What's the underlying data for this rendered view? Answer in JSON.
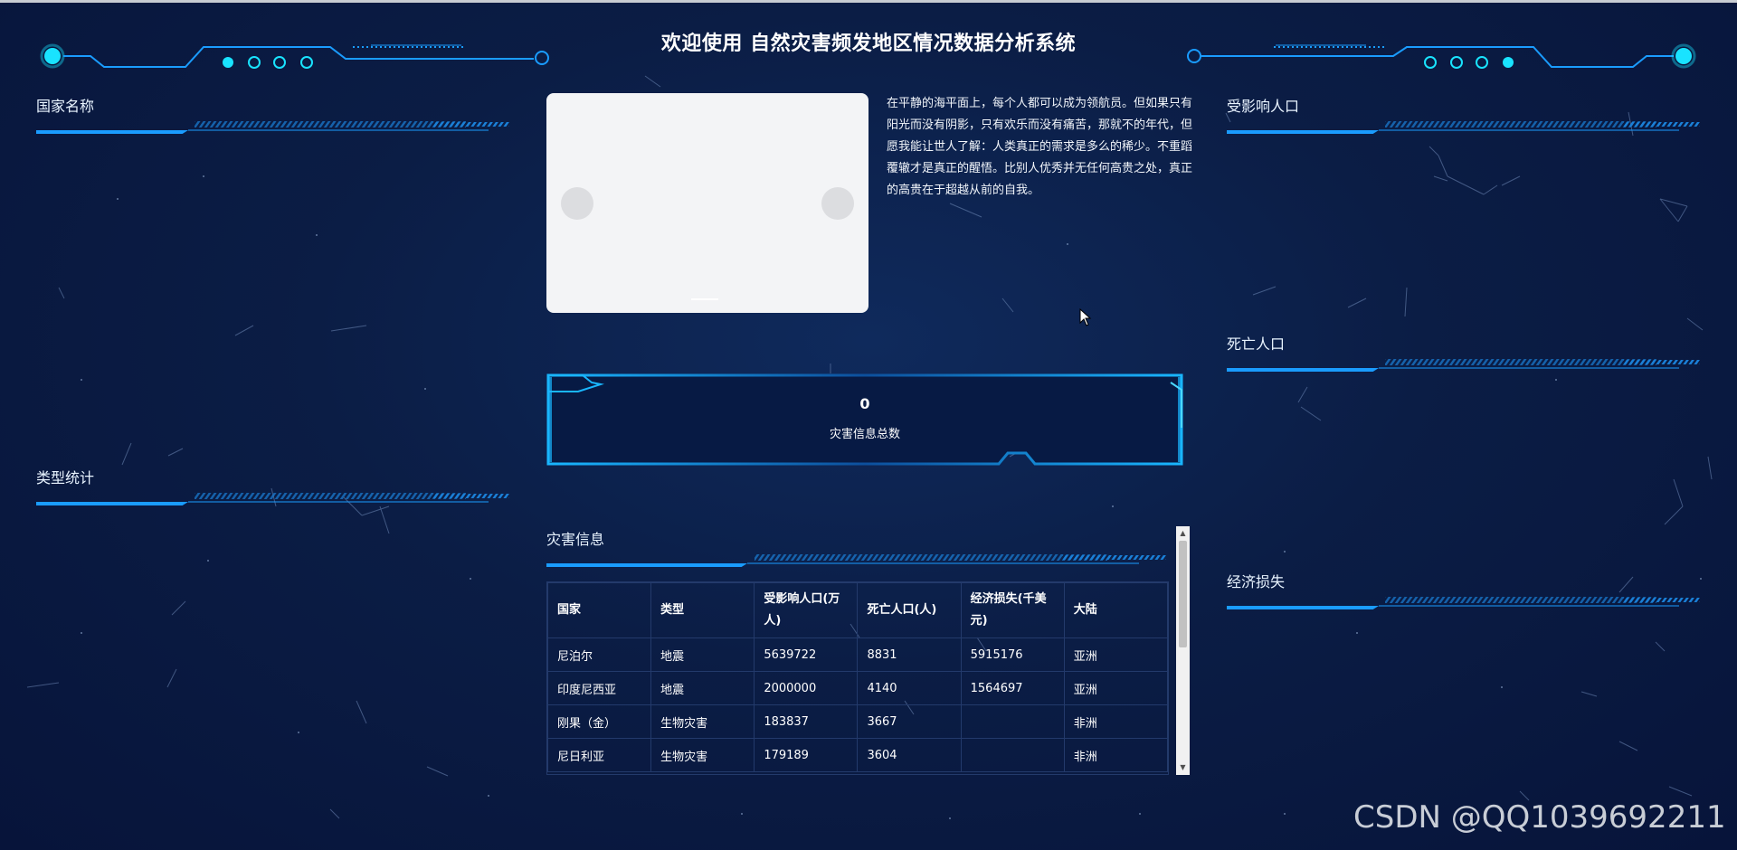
{
  "header": {
    "title": "欢迎使用 自然灾害频发地区情况数据分析系统"
  },
  "panels": {
    "country_name": "国家名称",
    "type_stats": "类型统计",
    "affected_population": "受影响人口",
    "death_population": "死亡人口",
    "economic_loss": "经济损失",
    "disaster_info": "灾害信息"
  },
  "quote": "在平静的海平面上，每个人都可以成为领航员。但如果只有阳光而没有阴影，只有欢乐而没有痛苦，那就不的年代，但愿我能让世人了解：人类真正的需求是多么的稀少。不重蹈覆辙才是真正的醒悟。比别人优秀并无任何高贵之处，真正的高贵在于超越从前的自我。",
  "total": {
    "value": "0",
    "label": "灾害信息总数"
  },
  "table": {
    "headers": [
      "国家",
      "类型",
      "受影响人口(万人)",
      "死亡人口(人)",
      "经济损失(千美元)",
      "大陆"
    ],
    "rows": [
      [
        "尼泊尔",
        "地震",
        "5639722",
        "8831",
        "5915176",
        "亚洲"
      ],
      [
        "印度尼西亚",
        "地震",
        "2000000",
        "4140",
        "1564697",
        "亚洲"
      ],
      [
        "刚果（金）",
        "生物灾害",
        "183837",
        "3667",
        "",
        "非洲"
      ],
      [
        "尼日利亚",
        "生物灾害",
        "179189",
        "3604",
        "",
        "非洲"
      ]
    ]
  },
  "watermark": "CSDN @QQ1039692211",
  "colors": {
    "accent": "#1a9cff",
    "cyan": "#19e3ff",
    "background": "#0b1d45"
  }
}
